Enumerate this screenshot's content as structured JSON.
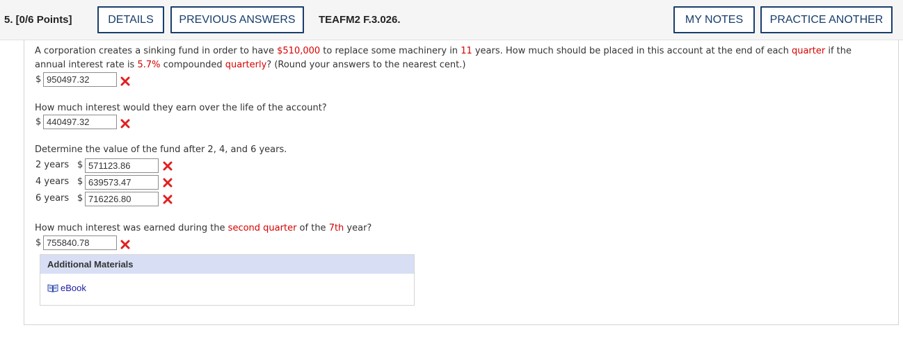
{
  "header": {
    "question_label": "5. [0/6 Points]",
    "details_label": "DETAILS",
    "previous_answers_label": "PREVIOUS ANSWERS",
    "question_id": "TEAFM2 F.3.026.",
    "my_notes_label": "MY NOTES",
    "practice_another_label": "PRACTICE ANOTHER"
  },
  "question": {
    "line1_a": "A corporation creates a sinking fund in order to have ",
    "amount": "$510,000",
    "line1_b": " to replace some machinery in ",
    "years": "11",
    "line1_c": " years. How much should be placed in this account at the end of each ",
    "quarter": "quarter",
    "line1_d": " if the",
    "line2_a": "annual interest rate is ",
    "rate": "5.7%",
    "line2_b": " compounded ",
    "quarterly": "quarterly",
    "line2_c": "? (Round your answers to the nearest cent.)",
    "answer1": "950497.32",
    "part2": "How much interest would they earn over the life of the account?",
    "answer2": "440497.32",
    "part3": "Determine the value of the fund after 2, 4, and 6 years.",
    "rows": [
      {
        "label": "2 years",
        "value": "571123.86"
      },
      {
        "label": "4 years",
        "value": "639573.47"
      },
      {
        "label": "6 years",
        "value": "716226.80"
      }
    ],
    "part4_a": "How much interest was earned during the ",
    "second_quarter": "second quarter",
    "part4_b": " of the ",
    "seventh": "7th",
    "part4_c": " year?",
    "answer4": "755840.78",
    "currency": "$"
  },
  "additional": {
    "title": "Additional Materials",
    "ebook_label": "eBook"
  },
  "colors": {
    "accent": "#173d6b",
    "highlight": "#d60000",
    "incorrect": "#e02020"
  }
}
